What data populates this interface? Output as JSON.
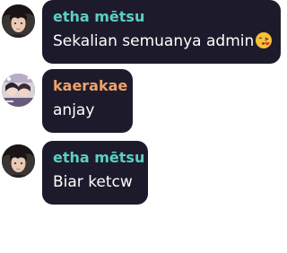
{
  "messages": [
    {
      "username": "etha mētsu",
      "username_color": "#5ccfc4",
      "text": "Sekalian semuanya admin",
      "emoji": "kissing-face-emoji"
    },
    {
      "username": "kaerakae",
      "username_color": "#f0a36b",
      "text": "anjay"
    },
    {
      "username": "etha mētsu",
      "username_color": "#5ccfc4",
      "text": "Biar ketcw"
    }
  ]
}
